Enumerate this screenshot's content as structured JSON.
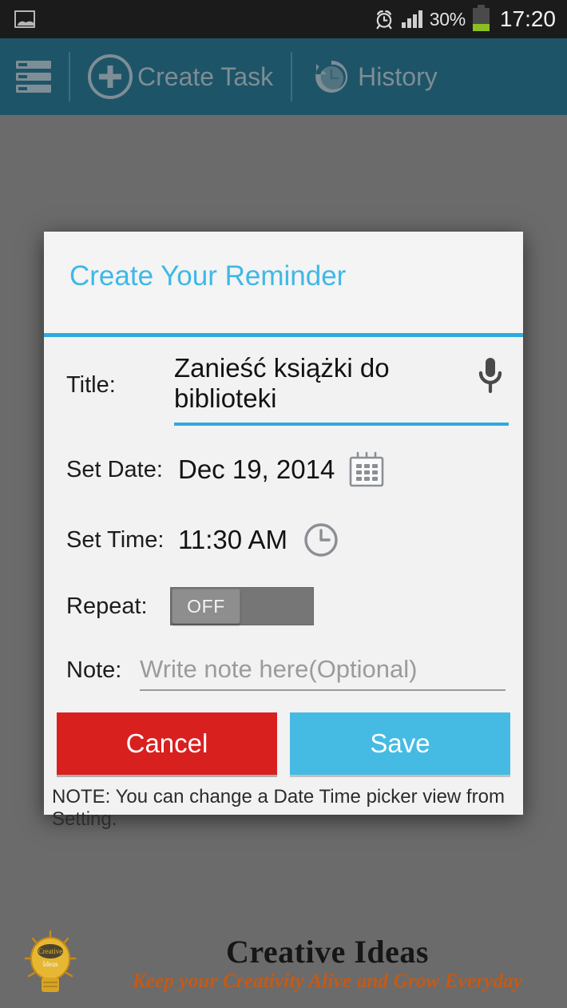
{
  "statusbar": {
    "left_icon": "screenshot-image-icon",
    "alarm_icon": "alarm-clock-icon",
    "signal_icon": "signal-bars-icon",
    "battery_percent": "30%",
    "battery_icon": "battery-icon",
    "battery_level": 30,
    "time": "17:20"
  },
  "toolbar": {
    "menu_icon": "list-menu-icon",
    "create_task_label": "Create Task",
    "create_task_icon": "plus-circle-icon",
    "history_label": "History",
    "history_icon": "history-clock-icon",
    "background_color": "#1e5468",
    "text_color": "#7d8d95"
  },
  "dialog": {
    "title": "Create Your Reminder",
    "accent_color": "#2eaadc",
    "title_color": "#3fb8e5",
    "fields": {
      "title_label": "Title:",
      "title_value": "Zanieść książki do biblioteki",
      "mic_icon": "microphone-icon",
      "date_label": "Set Date:",
      "date_value": "Dec 19, 2014",
      "calendar_icon": "calendar-icon",
      "time_label": "Set Time:",
      "time_value": "11:30 AM",
      "clock_icon": "clock-icon",
      "repeat_label": "Repeat:",
      "repeat_state": "OFF",
      "note_label": "Note:",
      "note_value": "",
      "note_placeholder": "Write note here(Optional)"
    },
    "buttons": {
      "cancel_label": "Cancel",
      "cancel_color": "#d8201f",
      "save_label": "Save",
      "save_color": "#45bbe4"
    },
    "footer_note": "NOTE: You can change a Date Time picker view from Setting."
  },
  "watermark": {
    "bulb_icon": "lightbulb-logo-icon",
    "title": "Creative Ideas",
    "tagline": "Keep your Creativity Alive and Grow Everyday",
    "title_color": "#161616",
    "tagline_color": "#c45a16"
  }
}
